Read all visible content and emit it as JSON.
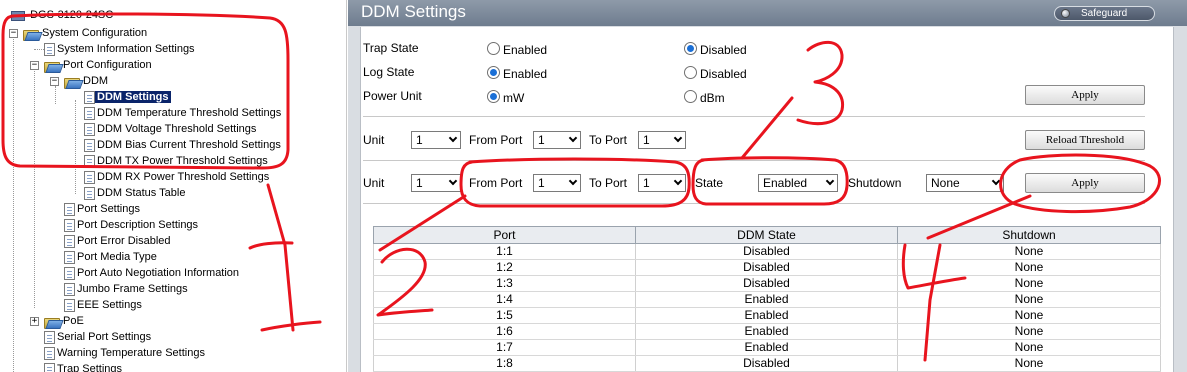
{
  "tree": {
    "root_label": "DGS-3120-24SC",
    "items": [
      {
        "label": "System Configuration"
      },
      {
        "label": "System Information Settings"
      },
      {
        "label": "Port Configuration"
      },
      {
        "label": "DDM"
      },
      {
        "label": "DDM Settings"
      },
      {
        "label": "DDM Temperature Threshold Settings"
      },
      {
        "label": "DDM Voltage Threshold Settings"
      },
      {
        "label": "DDM Bias Current Threshold Settings"
      },
      {
        "label": "DDM TX Power Threshold Settings"
      },
      {
        "label": "DDM RX Power Threshold Settings"
      },
      {
        "label": "DDM Status Table"
      },
      {
        "label": "Port Settings"
      },
      {
        "label": "Port Description Settings"
      },
      {
        "label": "Port Error Disabled"
      },
      {
        "label": "Port Media Type"
      },
      {
        "label": "Port Auto Negotiation Information"
      },
      {
        "label": "Jumbo Frame Settings"
      },
      {
        "label": "EEE Settings"
      },
      {
        "label": "PoE"
      },
      {
        "label": "Serial Port Settings"
      },
      {
        "label": "Warning Temperature Settings"
      },
      {
        "label": "Trap Settings"
      }
    ]
  },
  "header": {
    "title": "DDM Settings",
    "safeguard_label": "Safeguard"
  },
  "global": {
    "trap_state_label": "Trap State",
    "log_state_label": "Log  State",
    "power_unit_label": "Power  Unit",
    "enabled": "Enabled",
    "disabled": "Disabled",
    "mw": "mW",
    "dbm": "dBm",
    "apply_label": "Apply"
  },
  "threshold_row": {
    "unit_label": "Unit",
    "unit_value": "1",
    "from_port_label": "From Port",
    "from_port_value": "1",
    "to_port_label": "To Port",
    "to_port_value": "1",
    "reload_label": "Reload Threshold"
  },
  "state_row": {
    "unit_label": "Unit",
    "unit_value": "1",
    "from_port_label": "From Port",
    "from_port_value": "1",
    "to_port_label": "To Port",
    "to_port_value": "1",
    "state_label": "State",
    "state_value": "Enabled",
    "shutdown_label": "Shutdown",
    "shutdown_value": "None",
    "apply_label": "Apply"
  },
  "table": {
    "headers": [
      "Port",
      "DDM State",
      "Shutdown"
    ],
    "rows": [
      [
        "1:1",
        "Disabled",
        "None"
      ],
      [
        "1:2",
        "Disabled",
        "None"
      ],
      [
        "1:3",
        "Disabled",
        "None"
      ],
      [
        "1:4",
        "Enabled",
        "None"
      ],
      [
        "1:5",
        "Enabled",
        "None"
      ],
      [
        "1:6",
        "Enabled",
        "None"
      ],
      [
        "1:7",
        "Enabled",
        "None"
      ],
      [
        "1:8",
        "Disabled",
        "None"
      ]
    ]
  },
  "annotations": {
    "numbers": [
      "1",
      "2",
      "3",
      "4"
    ],
    "color": "#e8141e"
  },
  "colors": {
    "titlebar": "#7a8799",
    "selected_tree_item": "#0a246a",
    "radio_on": "#1a6fd6"
  }
}
